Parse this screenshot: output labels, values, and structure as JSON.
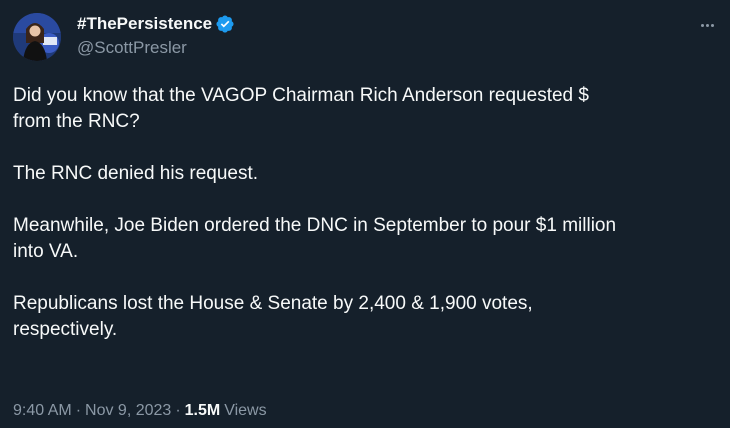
{
  "author": {
    "display_name": "#ThePersistence",
    "handle": "@ScottPresler",
    "verified": true,
    "accent_color": "#1d9bf0"
  },
  "more_icon": "more-horizontal-icon",
  "tweet": {
    "paragraphs": [
      "Did you know that the VAGOP Chairman Rich Anderson requested $\nfrom the RNC?",
      "The RNC denied his request.",
      "Meanwhile, Joe Biden ordered the DNC in September to pour $1 million\ninto VA.",
      "Republicans lost the House & Senate by 2,400 & 1,900 votes,\nrespectively."
    ]
  },
  "meta": {
    "time": "9:40 AM",
    "separator": "·",
    "date": "Nov 9, 2023",
    "views_count": "1.5M",
    "views_label": "Views"
  },
  "colors": {
    "background": "#15202b",
    "primary_text": "#f7f9f9",
    "secondary_text": "#8b98a5"
  }
}
